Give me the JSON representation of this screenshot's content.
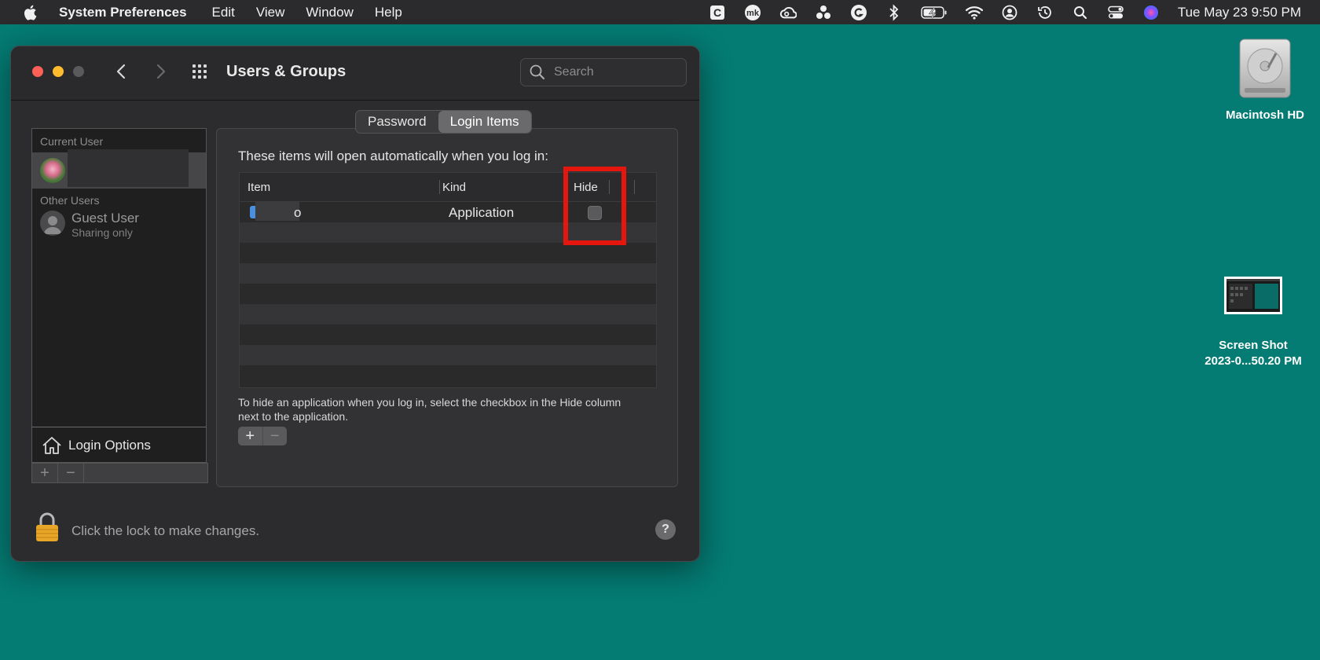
{
  "menubar": {
    "apple_icon": "apple-logo-icon",
    "app_name": "System Preferences",
    "menus": [
      "Edit",
      "View",
      "Window",
      "Help"
    ],
    "status_icons": [
      "clipboard-c-icon",
      "mk-icon",
      "creative-cloud-icon",
      "dots-icon",
      "grammarly-icon",
      "bluetooth-icon",
      "battery-icon",
      "wifi-icon",
      "user-icon",
      "time-machine-icon",
      "spotlight-icon",
      "control-center-icon",
      "siri-icon"
    ],
    "clock": "Tue May 23  9:50 PM"
  },
  "window": {
    "title": "Users & Groups",
    "search_placeholder": "Search",
    "sidebar": {
      "current_user_label": "Current User",
      "other_users_label": "Other Users",
      "guest_name": "Guest User",
      "guest_subtitle": "Sharing only",
      "login_options": "Login Options",
      "add": "+",
      "remove": "−"
    },
    "tabs": [
      {
        "label": "Password",
        "active": false
      },
      {
        "label": "Login Items",
        "active": true
      }
    ],
    "intro": "These items will open automatically when you log in:",
    "table": {
      "columns": [
        "Item",
        "Kind",
        "Hide"
      ],
      "rows": [
        {
          "item": "o",
          "kind": "Application",
          "hide": false
        }
      ]
    },
    "help_text": "To hide an application when you log in, select the checkbox in the Hide column next to the application.",
    "add": "+",
    "remove": "−",
    "lock_text": "Click the lock to make changes.",
    "help_button": "?"
  },
  "desktop": {
    "drive_label": "Macintosh HD",
    "screenshot_label_1": "Screen Shot",
    "screenshot_label_2": "2023-0...50.20 PM"
  },
  "colors": {
    "desktop": "#047b73",
    "highlight": "#e5160e"
  }
}
